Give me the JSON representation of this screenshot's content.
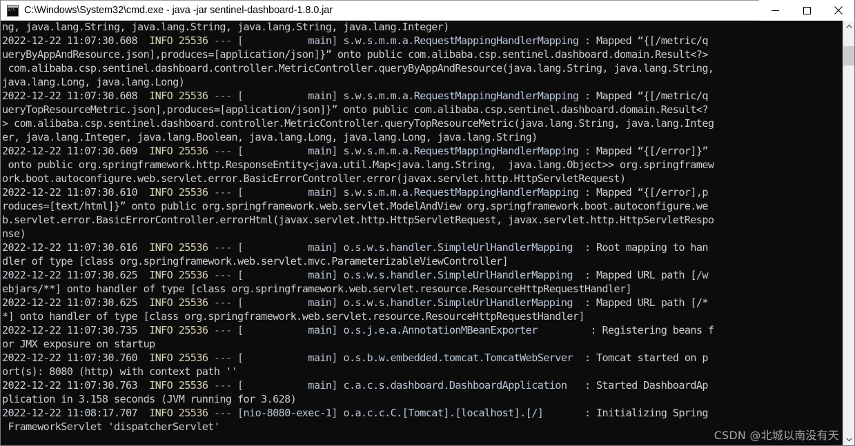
{
  "window": {
    "title": "C:\\Windows\\System32\\cmd.exe - java  -jar sentinel-dashboard-1.8.0.jar",
    "icon": "cmd-console-icon",
    "minimize_label": "Minimize",
    "maximize_label": "Maximize",
    "close_label": "Close",
    "background_color": "#0c0c0c",
    "titlebar_color": "#ffffff"
  },
  "scrollbar": {
    "up_arrow": "scroll-up-arrow",
    "down_arrow": "scroll-down-arrow",
    "thumb_position_percent": 4
  },
  "watermark": {
    "text": "CSDN @北城以南没有天"
  },
  "console": {
    "font_size_px": 15.2,
    "line_height_px": 20.03,
    "foreground_color": "#cccccc",
    "lines": [
      "ng, java.lang.String, java.lang.String, java.lang.String, java.lang.Integer)",
      "2022-12-22 11:07:30.608  INFO 25536 --- [           main] s.w.s.m.m.a.RequestMappingHandlerMapping : Mapped “{[/metric/q",
      "ueryByAppAndResource.json],produces=[application/json]}” onto public com.alibaba.csp.sentinel.dashboard.domain.Result<?>",
      " com.alibaba.csp.sentinel.dashboard.controller.MetricController.queryByAppAndResource(java.lang.String, java.lang.String,",
      "java.lang.Long, java.lang.Long)",
      "2022-12-22 11:07:30.608  INFO 25536 --- [           main] s.w.s.m.m.a.RequestMappingHandlerMapping : Mapped “{[/metric/q",
      "ueryTopResourceMetric.json],produces=[application/json]}” onto public com.alibaba.csp.sentinel.dashboard.domain.Result<?",
      "> com.alibaba.csp.sentinel.dashboard.controller.MetricController.queryTopResourceMetric(java.lang.String, java.lang.Integ",
      "er, java.lang.Integer, java.lang.Boolean, java.lang.Long, java.lang.Long, java.lang.String)",
      "2022-12-22 11:07:30.609  INFO 25536 --- [           main] s.w.s.m.m.a.RequestMappingHandlerMapping : Mapped “{[/error]}”",
      " onto public org.springframework.http.ResponseEntity<java.util.Map<java.lang.String,  java.lang.Object>> org.springframew",
      "ork.boot.autoconfigure.web.servlet.error.BasicErrorController.error(javax.servlet.http.HttpServletRequest)",
      "2022-12-22 11:07:30.610  INFO 25536 --- [           main] s.w.s.m.m.a.RequestMappingHandlerMapping : Mapped “{[/error],p",
      "roduces=[text/html]}” onto public org.springframework.web.servlet.ModelAndView org.springframework.boot.autoconfigure.we",
      "b.servlet.error.BasicErrorController.errorHtml(javax.servlet.http.HttpServletRequest, javax.servlet.http.HttpServletRespo",
      "nse)",
      "2022-12-22 11:07:30.616  INFO 25536 --- [           main] o.s.w.s.handler.SimpleUrlHandlerMapping  : Root mapping to han",
      "dler of type [class org.springframework.web.servlet.mvc.ParameterizableViewController]",
      "2022-12-22 11:07:30.625  INFO 25536 --- [           main] o.s.w.s.handler.SimpleUrlHandlerMapping  : Mapped URL path [/w",
      "ebjars/**] onto handler of type [class org.springframework.web.servlet.resource.ResourceHttpRequestHandler]",
      "2022-12-22 11:07:30.625  INFO 25536 --- [           main] o.s.w.s.handler.SimpleUrlHandlerMapping  : Mapped URL path [/*",
      "*] onto handler of type [class org.springframework.web.servlet.resource.ResourceHttpRequestHandler]",
      "2022-12-22 11:07:30.735  INFO 25536 --- [           main] o.s.j.e.a.AnnotationMBeanExporter         : Registering beans f",
      "or JMX exposure on startup",
      "2022-12-22 11:07:30.760  INFO 25536 --- [           main] o.s.b.w.embedded.tomcat.TomcatWebServer  : Tomcat started on p",
      "ort(s): 8080 (http) with context path ''",
      "2022-12-22 11:07:30.763  INFO 25536 --- [           main] c.a.c.s.dashboard.DashboardApplication   : Started DashboardAp",
      "plication in 3.158 seconds (JVM running for 3.628)",
      "2022-12-22 11:08:17.707  INFO 25536 --- [nio-8080-exec-1] o.a.c.c.C.[Tomcat].[localhost].[/]       : Initializing Spring",
      " FrameworkServlet 'dispatcherServlet'"
    ]
  }
}
